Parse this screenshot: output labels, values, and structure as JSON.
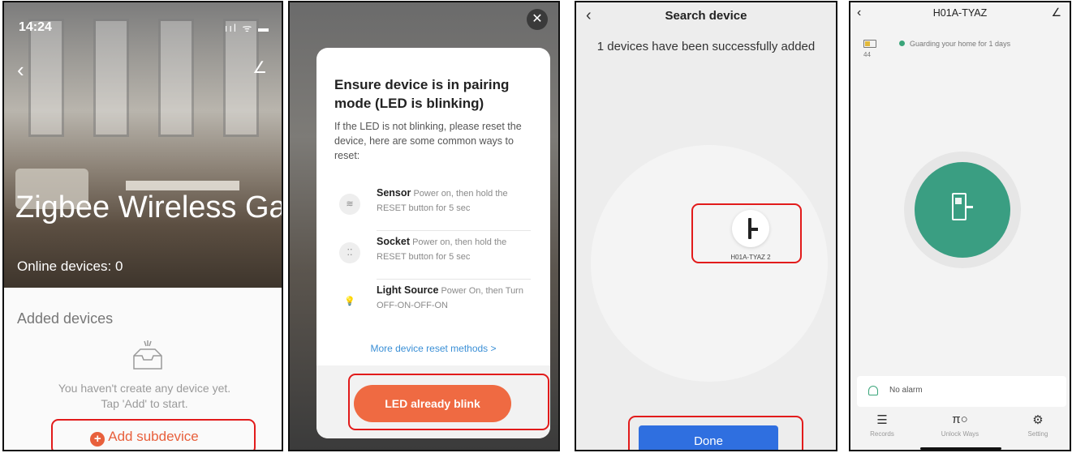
{
  "colors": {
    "red_highlight": "#e21b1b",
    "orange": "#ef6a42",
    "blue_button": "#2f6fe0",
    "green": "#3a9e82",
    "link_blue": "#3a8fd6"
  },
  "panel1": {
    "status_time": "14:24",
    "status_icons": "ııl ᯤ ▬",
    "back_icon": "back-icon",
    "title": "Zigbee Wireless Gate...",
    "online_devices": "Online devices: 0",
    "added_devices_label": "Added devices",
    "empty_line1": "You haven't create any device yet.",
    "empty_line2": "Tap 'Add' to start.",
    "add_subdevice": "Add subdevice"
  },
  "panel2": {
    "modal_title": "Ensure device is in pairing mode (LED is blinking)",
    "modal_desc": "If the LED is not blinking, please reset the device, here are some common ways to reset:",
    "methods": [
      {
        "name": "Sensor",
        "desc": "Power on, then hold the RESET button for 5 sec",
        "icon": "≋"
      },
      {
        "name": "Socket",
        "desc": "Power on, then hold the RESET button for 5 sec",
        "icon": "⁚⁚"
      },
      {
        "name": "Light Source",
        "desc": "Power On, then Turn OFF-ON-OFF-ON",
        "icon": "💡"
      }
    ],
    "more_methods": "More device reset methods >",
    "led_button": "LED already blink"
  },
  "panel3": {
    "title": "Search device",
    "added_message": "1 devices have been successfully added",
    "device_name": "H01A-TYAZ 2",
    "done_button": "Done"
  },
  "panel4": {
    "title": "H01A-TYAZ",
    "battery_level": "44",
    "guarding": "Guarding your home for 1 days",
    "alarm": "No alarm",
    "nav": [
      {
        "label": "Records",
        "icon": "☰"
      },
      {
        "label": "Unlock Ways",
        "icon": "π○"
      },
      {
        "label": "Setting",
        "icon": "⚙"
      }
    ]
  }
}
